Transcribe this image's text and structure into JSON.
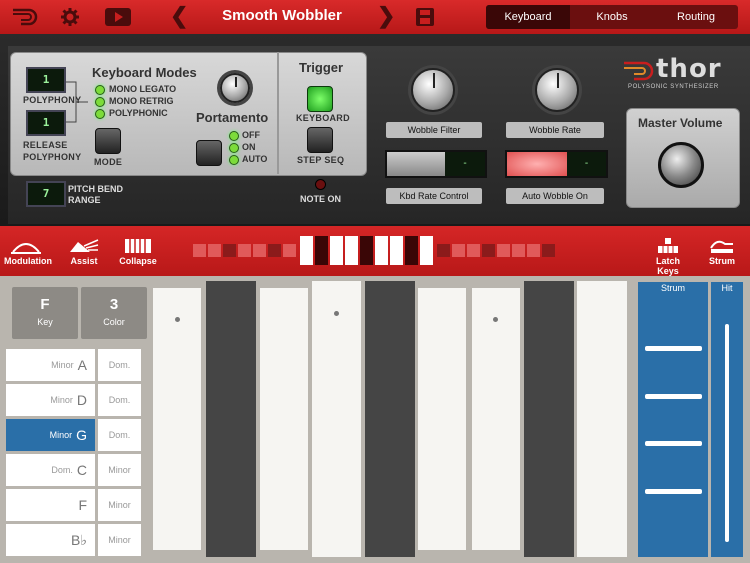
{
  "app": {
    "title": "Smooth Wobbler"
  },
  "tabs": [
    {
      "label": "Keyboard",
      "active": true
    },
    {
      "label": "Knobs",
      "active": false
    },
    {
      "label": "Routing",
      "active": false
    }
  ],
  "keyboard_panel": {
    "heading": "Keyboard Modes",
    "polyphony": {
      "value": "1",
      "label": "POLYPHONY"
    },
    "release_polyphony": {
      "value": "1",
      "label": "RELEASE POLYPHONY"
    },
    "mode_label": "MODE",
    "modes": [
      {
        "label": "MONO LEGATO",
        "on": true
      },
      {
        "label": "MONO RETRIG",
        "on": true
      },
      {
        "label": "POLYPHONIC",
        "on": true
      }
    ],
    "portamento": {
      "label": "Portamento",
      "options": [
        {
          "label": "OFF",
          "on": true
        },
        {
          "label": "ON",
          "on": true
        },
        {
          "label": "AUTO",
          "on": true
        }
      ]
    },
    "pitch_bend": {
      "value": "7",
      "label": "PITCH BEND RANGE"
    }
  },
  "trigger": {
    "heading": "Trigger",
    "keyboard_label": "KEYBOARD",
    "step_seq_label": "STEP SEQ",
    "note_on_label": "NOTE ON"
  },
  "knobs": {
    "wobble_filter": "Wobble Filter",
    "wobble_rate": "Wobble Rate",
    "kbd_rate_control": "Kbd Rate Control",
    "auto_wobble_on": "Auto Wobble On",
    "lcd_minus": "-"
  },
  "logo": {
    "name": "thor",
    "subtitle": "POLYSONIC SYNTHESIZER"
  },
  "master_volume": {
    "label": "Master Volume"
  },
  "strip": {
    "modulation": "Modulation",
    "assist": "Assist",
    "collapse": "Collapse",
    "latch_keys": "Latch Keys",
    "strum": "Strum"
  },
  "key_selector": {
    "key": {
      "value": "F",
      "label": "Key"
    },
    "color": {
      "value": "3",
      "label": "Color"
    }
  },
  "chords": [
    {
      "quality": "Minor",
      "root": "A",
      "alt": "Dom.",
      "selected": false
    },
    {
      "quality": "Minor",
      "root": "D",
      "alt": "Dom.",
      "selected": false
    },
    {
      "quality": "Minor",
      "root": "G",
      "alt": "Dom.",
      "selected": true
    },
    {
      "quality": "Dom.",
      "root": "C",
      "alt": "Minor",
      "selected": false
    },
    {
      "quality": "",
      "root": "F",
      "alt": "Minor",
      "selected": false
    },
    {
      "quality": "",
      "root": "B♭",
      "alt": "Minor",
      "selected": false
    }
  ],
  "strum_panel": {
    "strum_label": "Strum",
    "hit_label": "Hit"
  },
  "colors": {
    "accent_red": "#c81e1e",
    "selected_blue": "#2a6fa8"
  }
}
